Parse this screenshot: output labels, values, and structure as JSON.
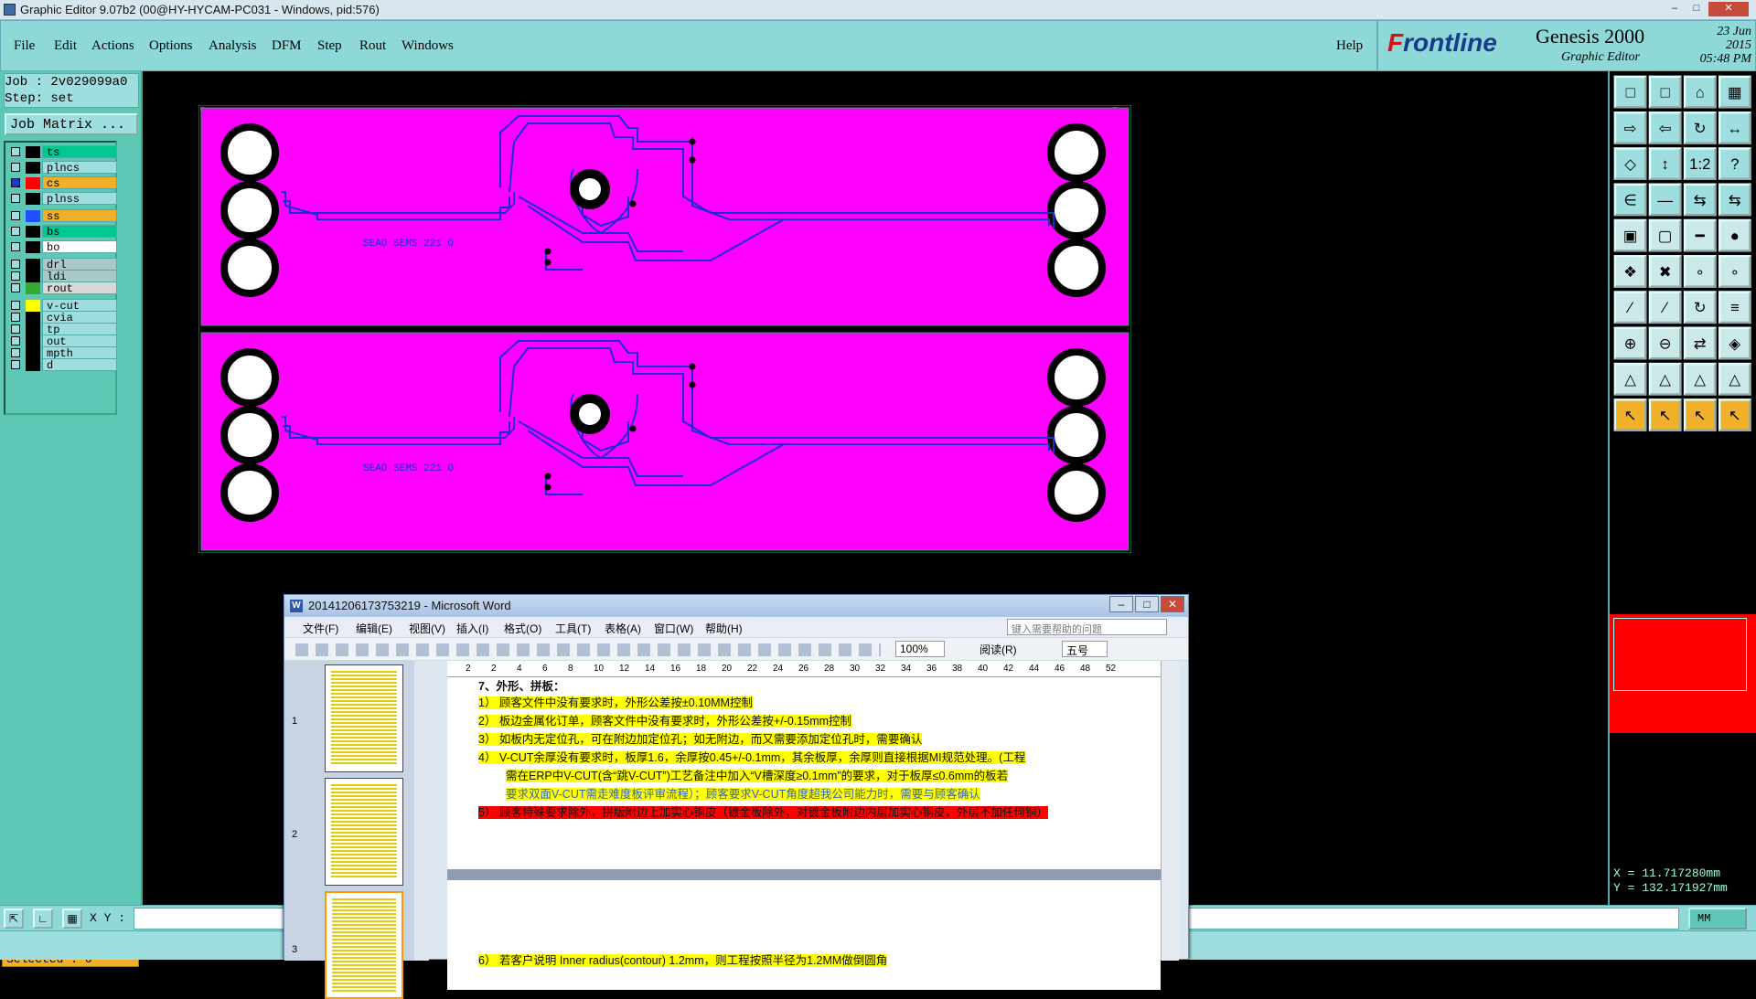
{
  "titlebar": {
    "title": "Graphic Editor 9.07b2 (00@HY-HYCAM-PC031 - Windows, pid:576)"
  },
  "menu": [
    "File",
    "Edit",
    "Actions",
    "Options",
    "Analysis",
    "DFM",
    "Step",
    "Rout",
    "Windows"
  ],
  "help_label": "Help",
  "brand": {
    "logo_a": "F",
    "logo_b": "rontline",
    "product": "Genesis 2000",
    "subtitle": "Graphic Editor",
    "date": "23 Jun 2015",
    "time": "05:48 PM"
  },
  "job": {
    "job": "Job : 2v029099a0",
    "step": "Step: set",
    "matrix_button": "Job Matrix ..."
  },
  "layers": [
    {
      "name": "ts",
      "color": "#00c890",
      "swatch": "#000",
      "checked": false
    },
    {
      "name": "plncs",
      "color": "#9fdede",
      "swatch": "#000",
      "checked": false
    },
    {
      "name": "cs",
      "color": "#f0b02a",
      "swatch": "#f00",
      "checked": true
    },
    {
      "name": "plnss",
      "color": "#9fdede",
      "swatch": "#000",
      "checked": false
    },
    {
      "name": "ss",
      "color": "#f0b02a",
      "swatch": "#2050ff",
      "checked": false
    },
    {
      "name": "bs",
      "color": "#00c890",
      "swatch": "#000",
      "checked": false
    },
    {
      "name": "bo",
      "color": "#ffffff",
      "swatch": "#000",
      "checked": false
    },
    {
      "name": "drl",
      "color": "#a9c9c9",
      "swatch": "#000",
      "checked": false
    },
    {
      "name": "ldi",
      "color": "#a9c9c9",
      "swatch": "#000",
      "checked": false
    },
    {
      "name": "rout",
      "color": "#d8d8d8",
      "swatch": "#3a3",
      "checked": false
    },
    {
      "name": "v-cut",
      "color": "#9fdede",
      "swatch": "#ff0",
      "checked": false
    },
    {
      "name": "cvia",
      "color": "#9fdede",
      "swatch": "#000",
      "checked": false
    },
    {
      "name": "tp",
      "color": "#9fdede",
      "swatch": "#000",
      "checked": false
    },
    {
      "name": "out",
      "color": "#9fdede",
      "swatch": "#000",
      "checked": false
    },
    {
      "name": "mpth",
      "color": "#9fdede",
      "swatch": "#000",
      "checked": false
    },
    {
      "name": "d",
      "color": "#9fdede",
      "swatch": "#000",
      "checked": false
    }
  ],
  "selected": "Selected : 0",
  "board": {
    "fill": "#ff00ff",
    "trace_color": "#1e2bd0",
    "label": "SEAO SEMS 221 O"
  },
  "coords": {
    "x": "X =  11.717280mm",
    "y": "Y = 132.171927mm"
  },
  "bottom": {
    "xy_label": "X Y :",
    "units": "MM"
  },
  "word": {
    "title": "20141206173753219 - Microsoft Word",
    "menu": [
      "文件(F)",
      "编辑(E)",
      "视图(V)",
      "插入(I)",
      "格式(O)",
      "工具(T)",
      "表格(A)",
      "窗口(W)",
      "帮助(H)"
    ],
    "help_placeholder": "键入需要帮助的问题",
    "zoom": "100%",
    "read": "阅读(R)",
    "font_size": "五号",
    "ruler": [
      "2",
      "2",
      "4",
      "6",
      "8",
      "10",
      "12",
      "14",
      "16",
      "18",
      "20",
      "22",
      "24",
      "26",
      "28",
      "30",
      "32",
      "34",
      "36",
      "38",
      "40",
      "42",
      "44",
      "46",
      "48",
      "52"
    ],
    "pages": [
      "1",
      "2",
      "3"
    ],
    "heading": "7、外形、拼板：",
    "lines": [
      "1）  顾客文件中没有要求时，外形公差按±0.10MM控制",
      "2）  板边金属化订单，顾客文件中没有要求时，外形公差按+/-0.15mm控制",
      "3）  如板内无定位孔，可在附边加定位孔；如无附边，而又需要添加定位孔时，需要确认",
      "4）  V-CUT余厚没有要求时，板厚1.6，余厚按0.45+/-0.1mm，其余板厚，余厚则直接根据MI规范处理。(工程",
      "需在ERP中V-CUT(含“跳V-CUT”)工艺备注中加入“V槽深度≥0.1mm”的要求，对于板厚≤0.6mm的板若",
      "要求双面V-CUT需走难度板评审流程）；顾客要求V-CUT角度超我公司能力时，需要与顾客确认",
      "5）  顾客特殊要求除外，拼版附边上加实心铜皮（镀金板除外，对镀金板附边内层加实心铜皮，外层不加任何铜）",
      "6）  若客户说明 Inner radius(contour) 1.2mm，则工程按照半径为1.2MM做倒圆角"
    ]
  }
}
